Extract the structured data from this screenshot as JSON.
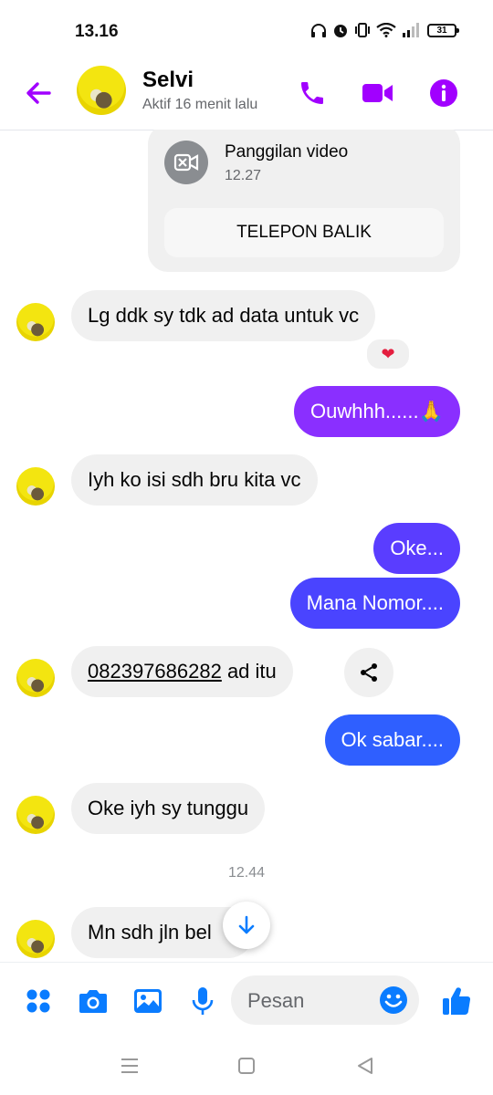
{
  "status_bar": {
    "time": "13.16",
    "battery": "31"
  },
  "header": {
    "name": "Selvi",
    "status": "Aktif 16 menit lalu"
  },
  "call_card": {
    "title": "Panggilan video",
    "time": "12.27",
    "button": "TELEPON BALIK"
  },
  "messages": [
    {
      "side": "in",
      "text": "Lg ddk sy tdk ad data untuk vc"
    },
    {
      "side": "out",
      "text": "Ouwhhh......🙏"
    },
    {
      "side": "in",
      "text": "Iyh ko isi sdh bru kita vc"
    },
    {
      "side": "out",
      "text": "Oke..."
    },
    {
      "side": "out",
      "text": "Mana Nomor...."
    },
    {
      "side": "in",
      "phone": "082397686282",
      "text": " ad itu"
    },
    {
      "side": "out",
      "text": "Ok sabar...."
    },
    {
      "side": "in",
      "text": "Oke iyh sy tunggu"
    },
    {
      "side": "in",
      "text": "Mn sdh jln bel"
    }
  ],
  "reaction": "❤",
  "timestamp": "12.44",
  "composer": {
    "placeholder": "Pesan"
  },
  "colors": {
    "accent": "#a033ff",
    "blue": "#0a7cff",
    "header_icons": "#a100ff"
  }
}
